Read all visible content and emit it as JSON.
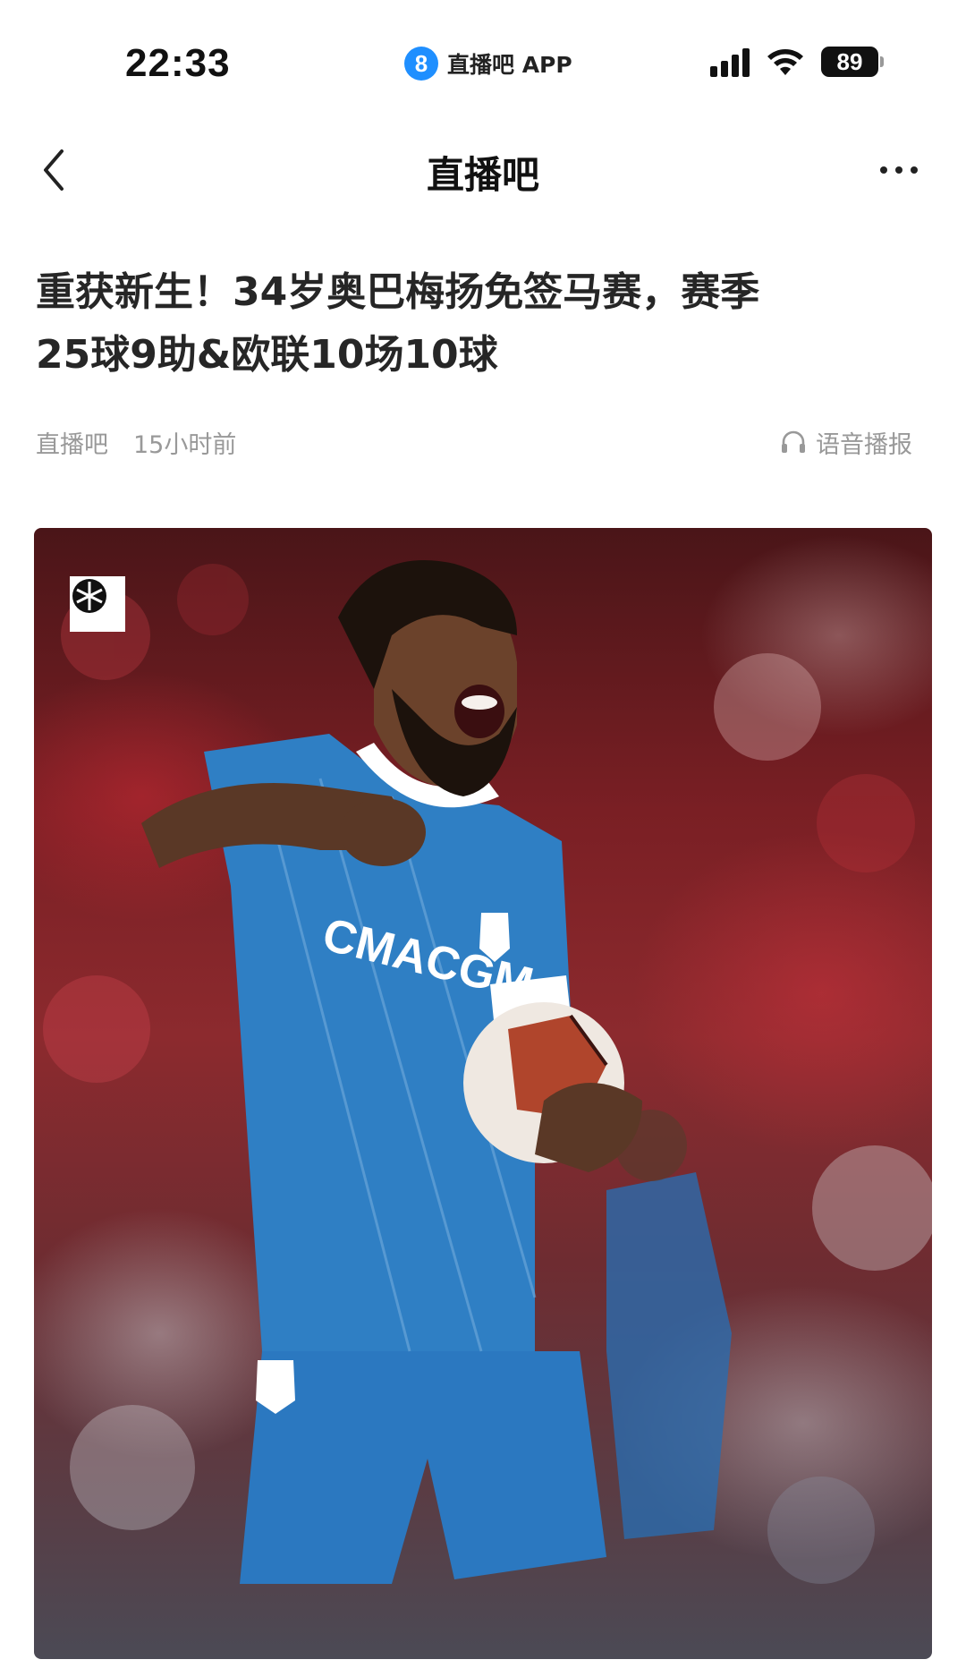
{
  "status_bar": {
    "time": "22:33",
    "app_badge": "8",
    "app_name": "直播吧 APP",
    "battery": "89"
  },
  "nav": {
    "title": "直播吧"
  },
  "article": {
    "title_line1": "重获新生！34岁奥巴梅扬免签马赛，赛季",
    "title_line2": "25球9助&欧联10场10球",
    "source": "直播吧",
    "time": "15小时前",
    "voice_label": "语音播报"
  },
  "hero": {
    "jersey_text": "CMACGM"
  },
  "colors": {
    "accent_blue": "#1f8fff",
    "meta_gray": "#999999",
    "jersey_blue": "#2f7fc4"
  }
}
